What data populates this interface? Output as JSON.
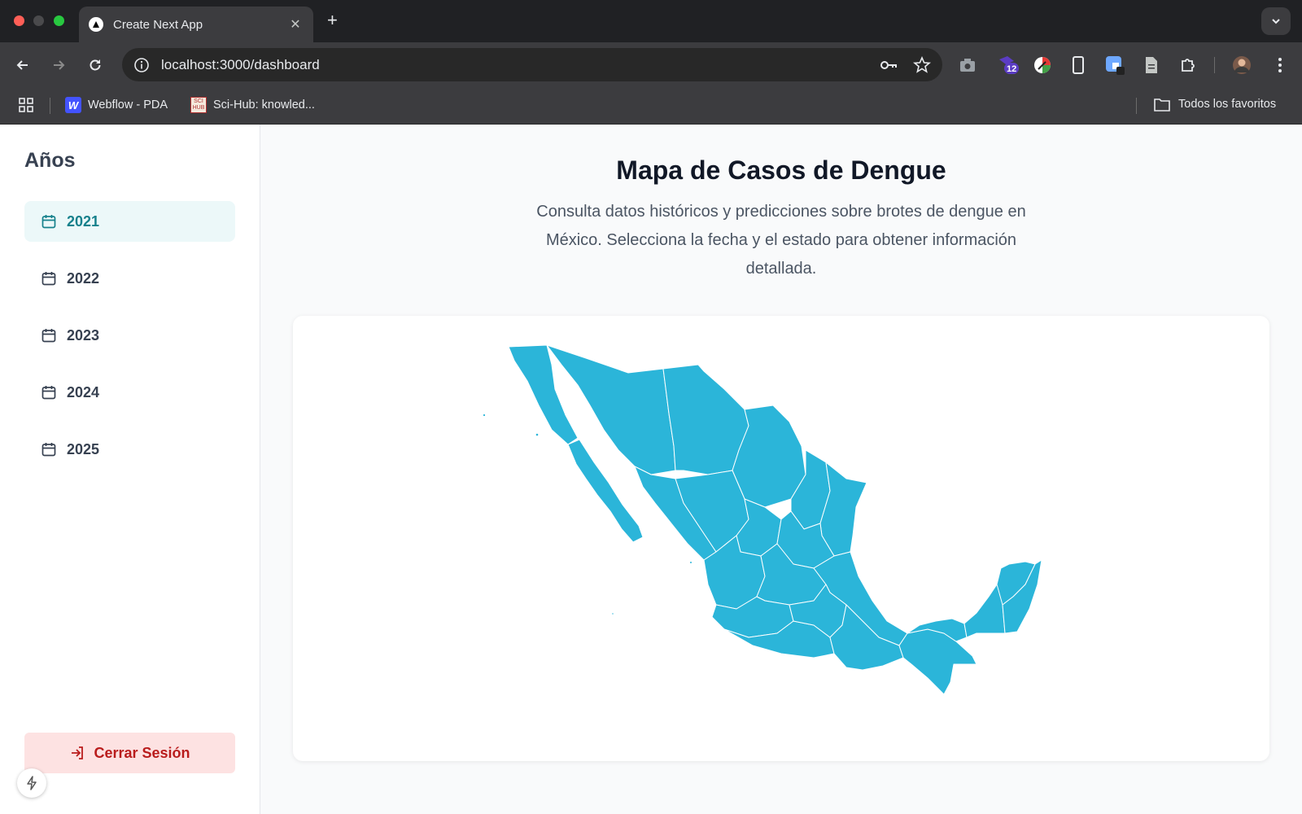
{
  "browser": {
    "tab_title": "Create Next App",
    "url": "localhost:3000/dashboard",
    "extension_badge": "12",
    "bookmarks": [
      {
        "label": "Webflow - PDA",
        "icon": "webflow-icon"
      },
      {
        "label": "Sci-Hub: knowled...",
        "icon": "scihub-icon"
      }
    ],
    "all_bookmarks_label": "Todos los favoritos"
  },
  "sidebar": {
    "title": "Años",
    "years": [
      {
        "label": "2021",
        "active": true
      },
      {
        "label": "2022",
        "active": false
      },
      {
        "label": "2023",
        "active": false
      },
      {
        "label": "2024",
        "active": false
      },
      {
        "label": "2025",
        "active": false
      }
    ],
    "logout_label": "Cerrar Sesión"
  },
  "main": {
    "title": "Mapa de Casos de Dengue",
    "subtitle": "Consulta datos históricos y predicciones sobre brotes de dengue en México. Selecciona la fecha y el estado para obtener información detallada."
  },
  "colors": {
    "accent": "#16818c",
    "map_fill": "#2bb5d9",
    "logout_bg": "#fde2e2",
    "logout_text": "#b91c1c"
  }
}
